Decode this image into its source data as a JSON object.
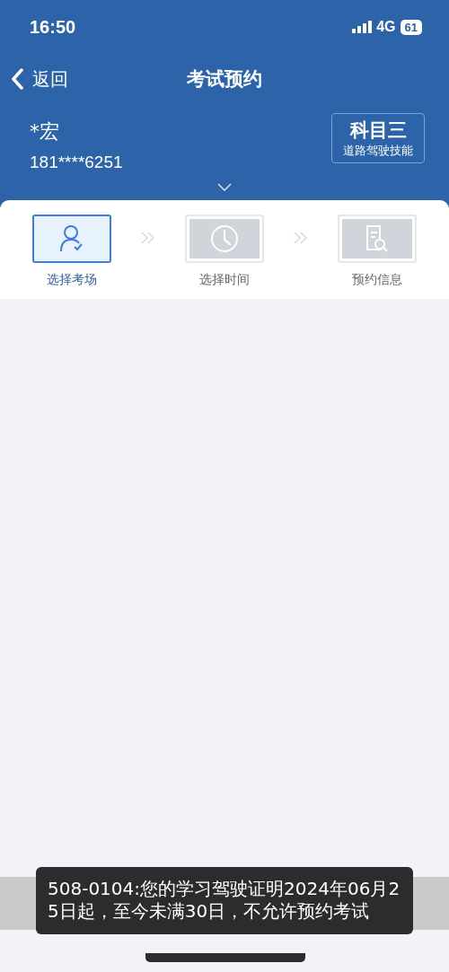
{
  "status_bar": {
    "time": "16:50",
    "network": "4G",
    "battery": "61"
  },
  "nav": {
    "back": "返回",
    "title": "考试预约"
  },
  "user": {
    "name": "*宏",
    "phone": "181****6251",
    "subject": "科目三",
    "subject_desc": "道路驾驶技能"
  },
  "steps": [
    {
      "label": "选择考场",
      "kind": "person",
      "selected": true
    },
    {
      "label": "选择时间",
      "kind": "clock",
      "selected": false
    },
    {
      "label": "预约信息",
      "kind": "document",
      "selected": false
    }
  ],
  "toast": "508-0104:您的学习驾驶证明2024年06月25日起，至今未满30日，不允许预约考试"
}
